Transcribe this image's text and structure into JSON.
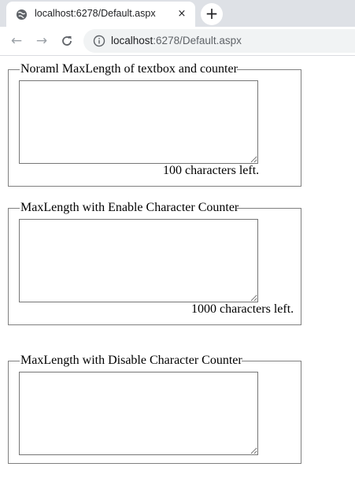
{
  "browser": {
    "tab_title": "localhost:6278/Default.aspx",
    "tab_close": "×",
    "new_tab": "+",
    "url_host": "localhost",
    "url_rest": ":6278/Default.aspx",
    "back": "←",
    "forward": "→",
    "reload": "C"
  },
  "sections": [
    {
      "legend": "Noraml MaxLength of textbox and counter",
      "textarea_value": "",
      "counter_text": "100 characters left."
    },
    {
      "legend": "MaxLength with Enable Character Counter",
      "textarea_value": "",
      "counter_text": "1000 characters left."
    },
    {
      "legend": "MaxLength with Disable Character Counter",
      "textarea_value": ""
    }
  ]
}
